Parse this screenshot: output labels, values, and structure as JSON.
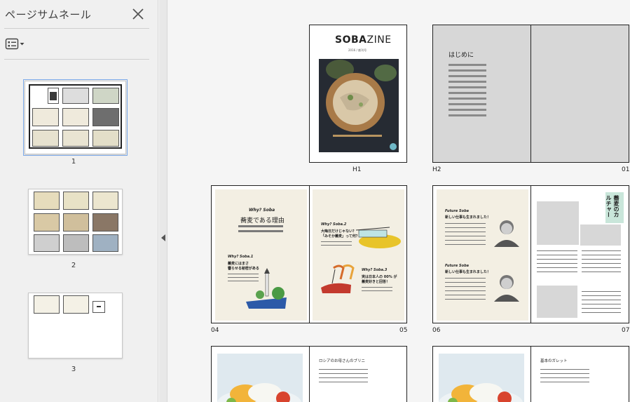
{
  "sidebar": {
    "title": "ページサムネール",
    "thumbnails": [
      {
        "label": "1"
      },
      {
        "label": "2"
      },
      {
        "label": "3"
      }
    ]
  },
  "pages": {
    "cover": {
      "brand_bold": "SOBA",
      "brand_light": "ZINE",
      "subtitle": "2016 / 創刊号",
      "label": "H1"
    },
    "h2_01": {
      "heading": "はじめに",
      "label_left": "H2",
      "label_right": "01"
    },
    "p04_05": {
      "why_title": "Why? Soba",
      "main_heading": "蕎麦である理由",
      "why1_title": "Why? Soba.1",
      "why1_text1": "蕎麦にはまさ",
      "why1_text2": "響らせる秘密がある",
      "why2_title": "Why? Soba.2",
      "why2_text1": "大晦日だけじゃない？",
      "why2_text2": "「みそか蕎麦」って何？",
      "why3_title": "Why? Soba.3",
      "why3_text1": "実は日本人の 00% が",
      "why3_text2": "蕎麦好きと回答！",
      "label_left": "04",
      "label_right": "05"
    },
    "p06_07": {
      "future1_title": "Future Soba",
      "future1_text": "新しい仕事も生まれました！",
      "future2_title": "Future Soba",
      "future2_text": "新しい仕事も生まれました！",
      "vertical_title": "蕎麦のカルチャー",
      "label_left": "06",
      "label_right": "07"
    },
    "p08": {
      "heading": "ロシアのお母さんのブリニ"
    },
    "p10": {
      "heading": "基本のガレット"
    }
  }
}
